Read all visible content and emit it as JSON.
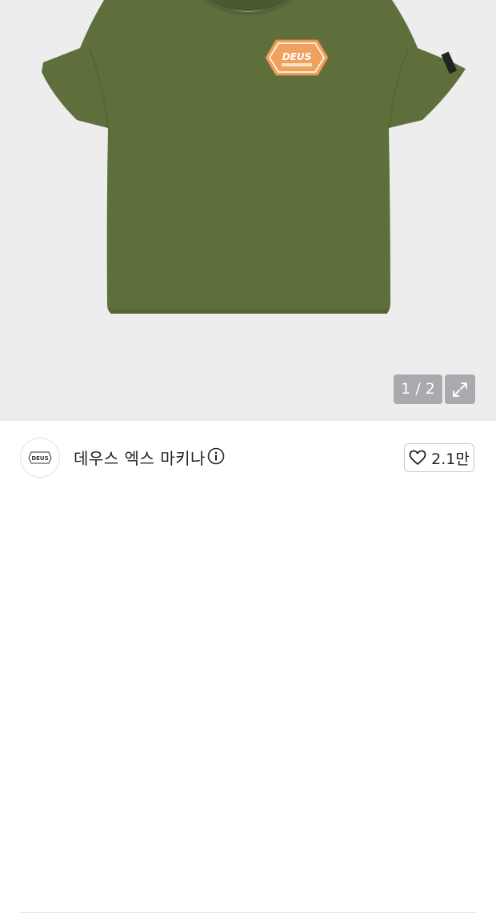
{
  "product": {
    "image_counter": "1 / 2",
    "logo_text": "DEUS",
    "tshirt_color": "#5f6f3b",
    "patch_color": "#f0a15e"
  },
  "brand": {
    "name": "데우스 엑스 마키나",
    "logo_text": "DEUS"
  },
  "like": {
    "count": "2.1만"
  }
}
